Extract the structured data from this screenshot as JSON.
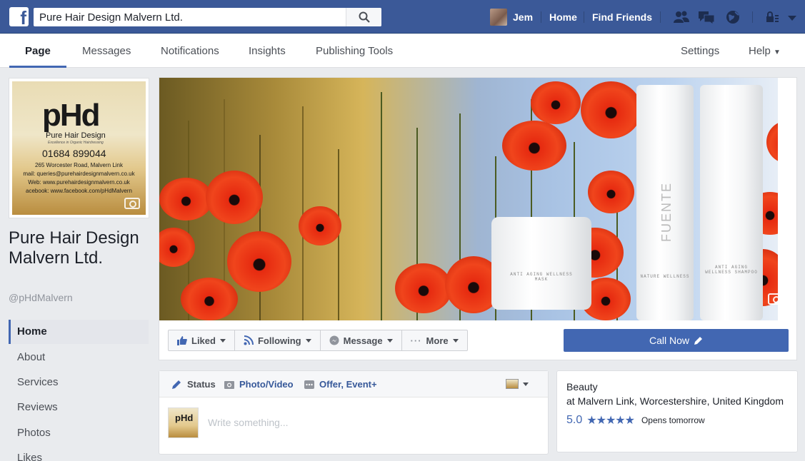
{
  "topbar": {
    "search_value": "Pure Hair Design Malvern Ltd.",
    "user_name": "Jem",
    "home": "Home",
    "find_friends": "Find Friends",
    "icons": [
      "friend-requests-icon",
      "messages-icon",
      "notifications-globe-icon",
      "privacy-lock-icon",
      "account-menu-icon"
    ],
    "brand_color": "#3b5998"
  },
  "page_nav": {
    "left": [
      "Page",
      "Messages",
      "Notifications",
      "Insights",
      "Publishing Tools"
    ],
    "settings": "Settings",
    "help": "Help"
  },
  "profile": {
    "logo_mark": "pHd",
    "logo_name": "Pure Hair Design",
    "logo_tagline": "Excellence in Organic Hairdressing",
    "logo_phone": "01684 899044",
    "logo_lines": [
      "265 Worcester Road, Malvern Link",
      "mail: queries@purehairdesignmalvern.co.uk",
      "Web: www.purehairdesignmalvern.co.uk",
      "acebook: www.facebook.com/pHdMalvern"
    ],
    "page_name": "Pure Hair Design Malvern Ltd.",
    "handle": "@pHdMalvern"
  },
  "sidebar": {
    "items": [
      {
        "label": "Home",
        "active": true
      },
      {
        "label": "About"
      },
      {
        "label": "Services"
      },
      {
        "label": "Reviews"
      },
      {
        "label": "Photos"
      },
      {
        "label": "Likes"
      }
    ]
  },
  "cover": {
    "products": [
      "ANTI AGING WELLNESS MASK",
      "NATURE WELLNESS",
      "ANTI AGING WELLNESS SHAMPOO"
    ],
    "brand": "FUENTE"
  },
  "actions": {
    "liked": "Liked",
    "following": "Following",
    "message": "Message",
    "more": "More",
    "call_now": "Call Now",
    "accent": "#4267b2"
  },
  "composer": {
    "status": "Status",
    "photo_video": "Photo/Video",
    "offer_event": "Offer, Event+",
    "placeholder": "Write something...",
    "avatar_mark": "pHd"
  },
  "about": {
    "category": "Beauty",
    "location": "at Malvern Link, Worcestershire, United Kingdom",
    "rating": "5.0",
    "stars": "★★★★★",
    "hours": "Opens tomorrow"
  }
}
